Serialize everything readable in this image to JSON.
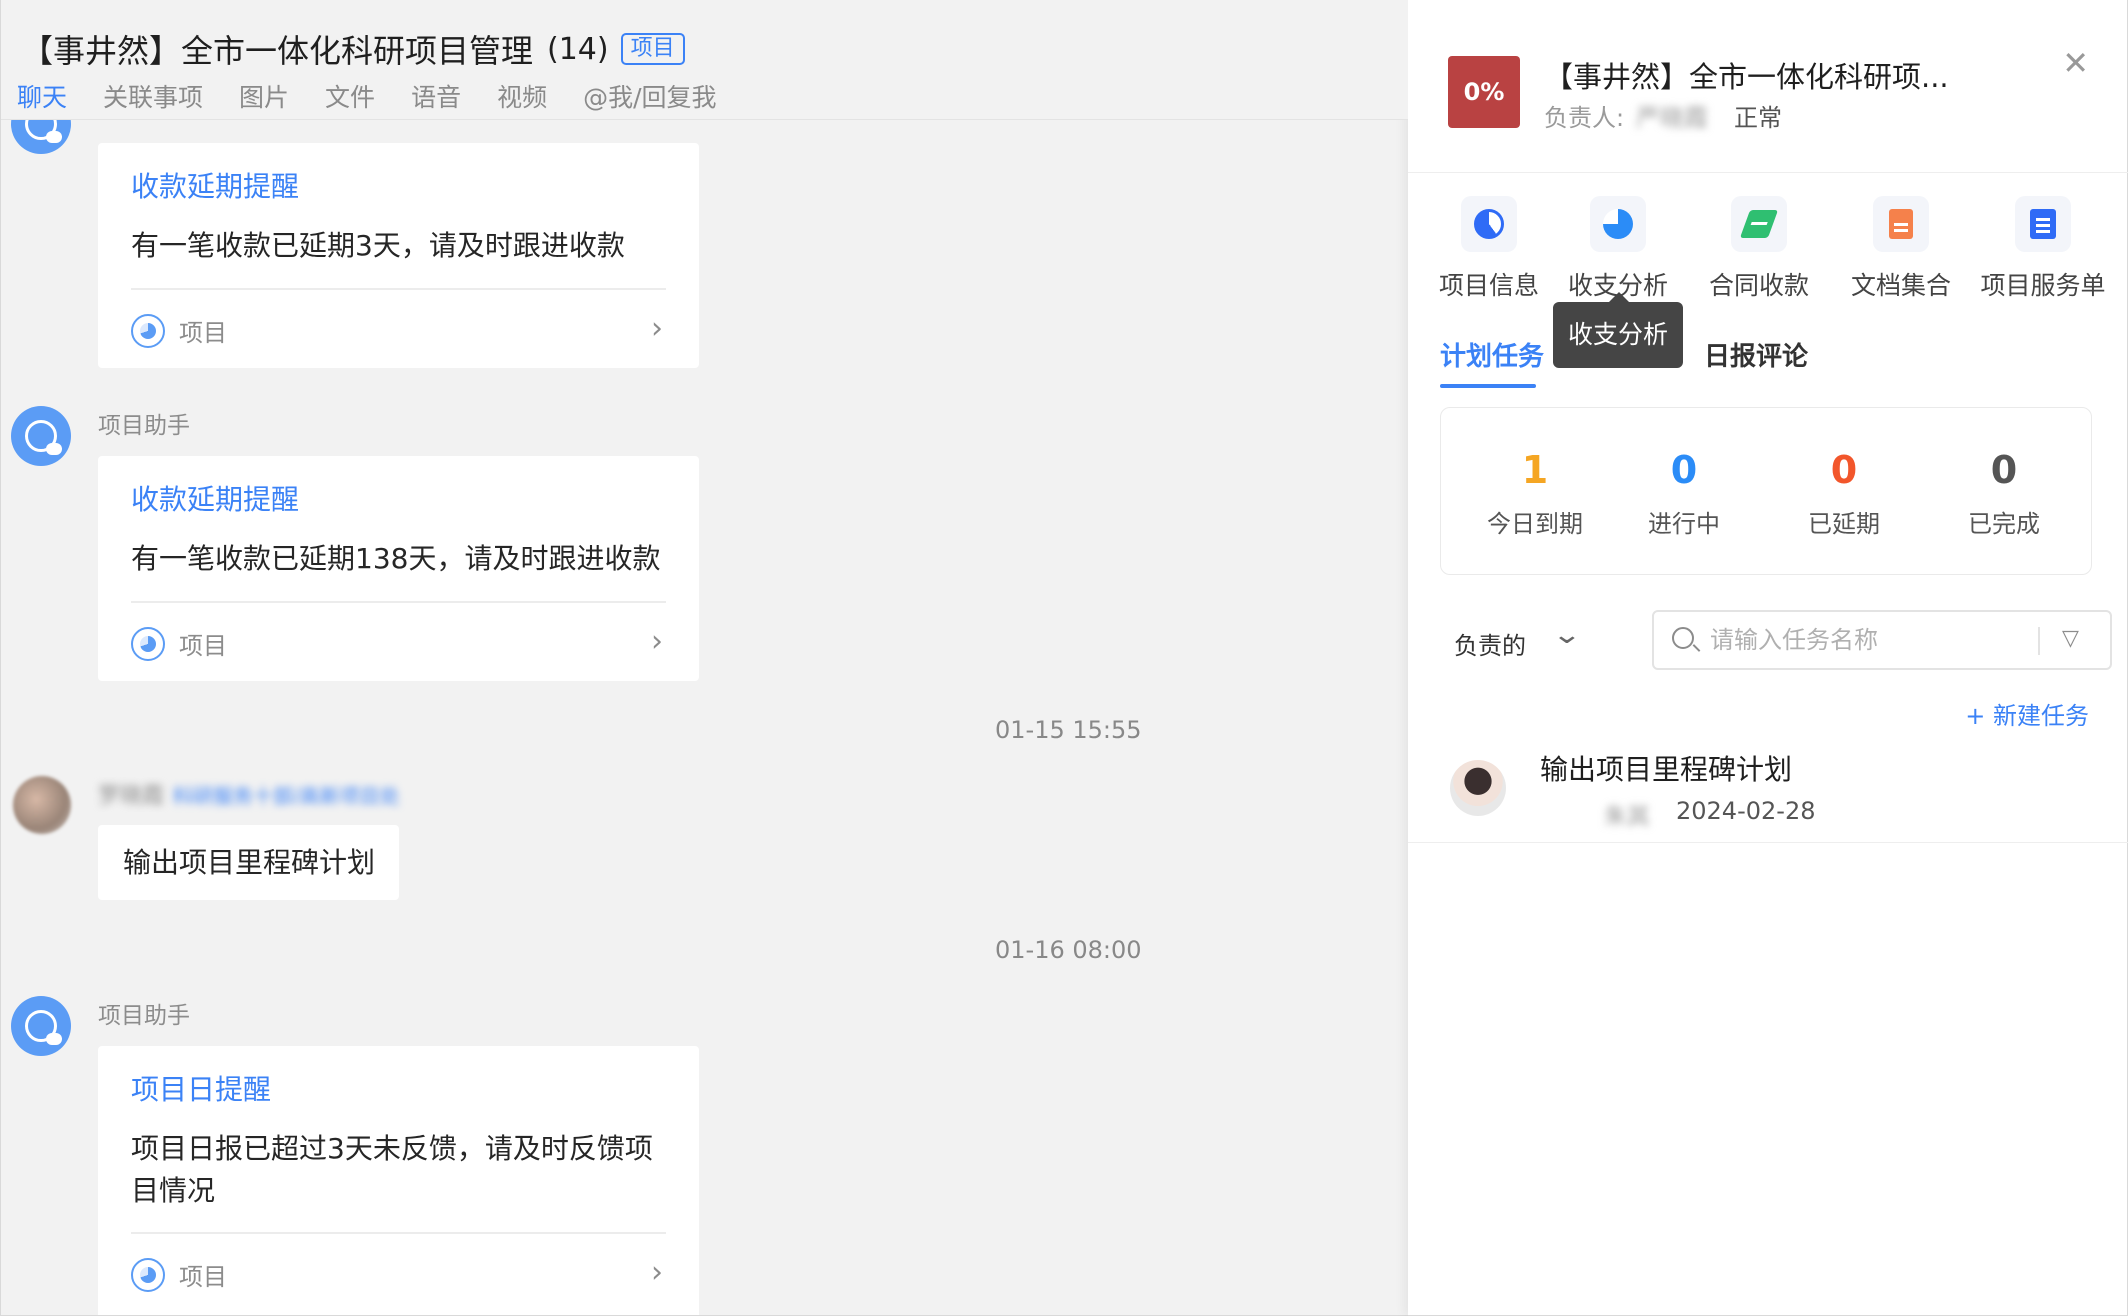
{
  "chat": {
    "title": "【事井然】全市一体化科研项目管理",
    "member_count": "(14)",
    "tag": "项目",
    "tabs": [
      "聊天",
      "关联事项",
      "图片",
      "文件",
      "语音",
      "视频",
      "@我/回复我"
    ],
    "sender_label": "项目助手",
    "messages": [
      {
        "title": "收款延期提醒",
        "text": "有一笔收款已延期3天，请及时跟进收款",
        "footer": "项目"
      },
      {
        "title": "收款延期提醒",
        "text": "有一笔收款已延期138天，请及时跟进收款",
        "footer": "项目"
      },
      {
        "title": "项目日提醒",
        "text": "项目日报已超过3天未反馈，请及时反馈项目情况",
        "footer": "项目"
      }
    ],
    "timestamps": [
      "01-15 15:55",
      "01-16 08:00"
    ],
    "user_message": {
      "name": "罗晓霞",
      "dept": "科研服务十部/高新项目处",
      "text": "输出项目里程碑计划"
    }
  },
  "panel": {
    "logo_text": "0%",
    "project_name": "【事井然】全市一体化科研项...",
    "owner_label": "负责人:",
    "owner_name": "严晓霞",
    "status": "正常",
    "functions": [
      {
        "label": "项目信息",
        "icon": "project-info-icon"
      },
      {
        "label": "收支分析",
        "icon": "income-analysis-icon"
      },
      {
        "label": "合同收款",
        "icon": "contract-icon"
      },
      {
        "label": "文档集合",
        "icon": "document-icon"
      },
      {
        "label": "项目服务单",
        "icon": "service-list-icon"
      }
    ],
    "tooltip": "收支分析",
    "tabs": {
      "plan": "计划任务",
      "daily": "日报评论"
    },
    "stats": [
      {
        "value": "1",
        "label": "今日到期",
        "color": "#f5a623"
      },
      {
        "value": "0",
        "label": "进行中",
        "color": "#2b8cf7"
      },
      {
        "value": "0",
        "label": "已延期",
        "color": "#f2562b"
      },
      {
        "value": "0",
        "label": "已完成",
        "color": "#555555"
      }
    ],
    "filter": {
      "selected": "负责的",
      "search_placeholder": "请输入任务名称"
    },
    "new_task": "+ 新建任务",
    "task": {
      "name": "输出项目里程碑计划",
      "assignee": "朱其",
      "date": "2024-02-28"
    }
  }
}
